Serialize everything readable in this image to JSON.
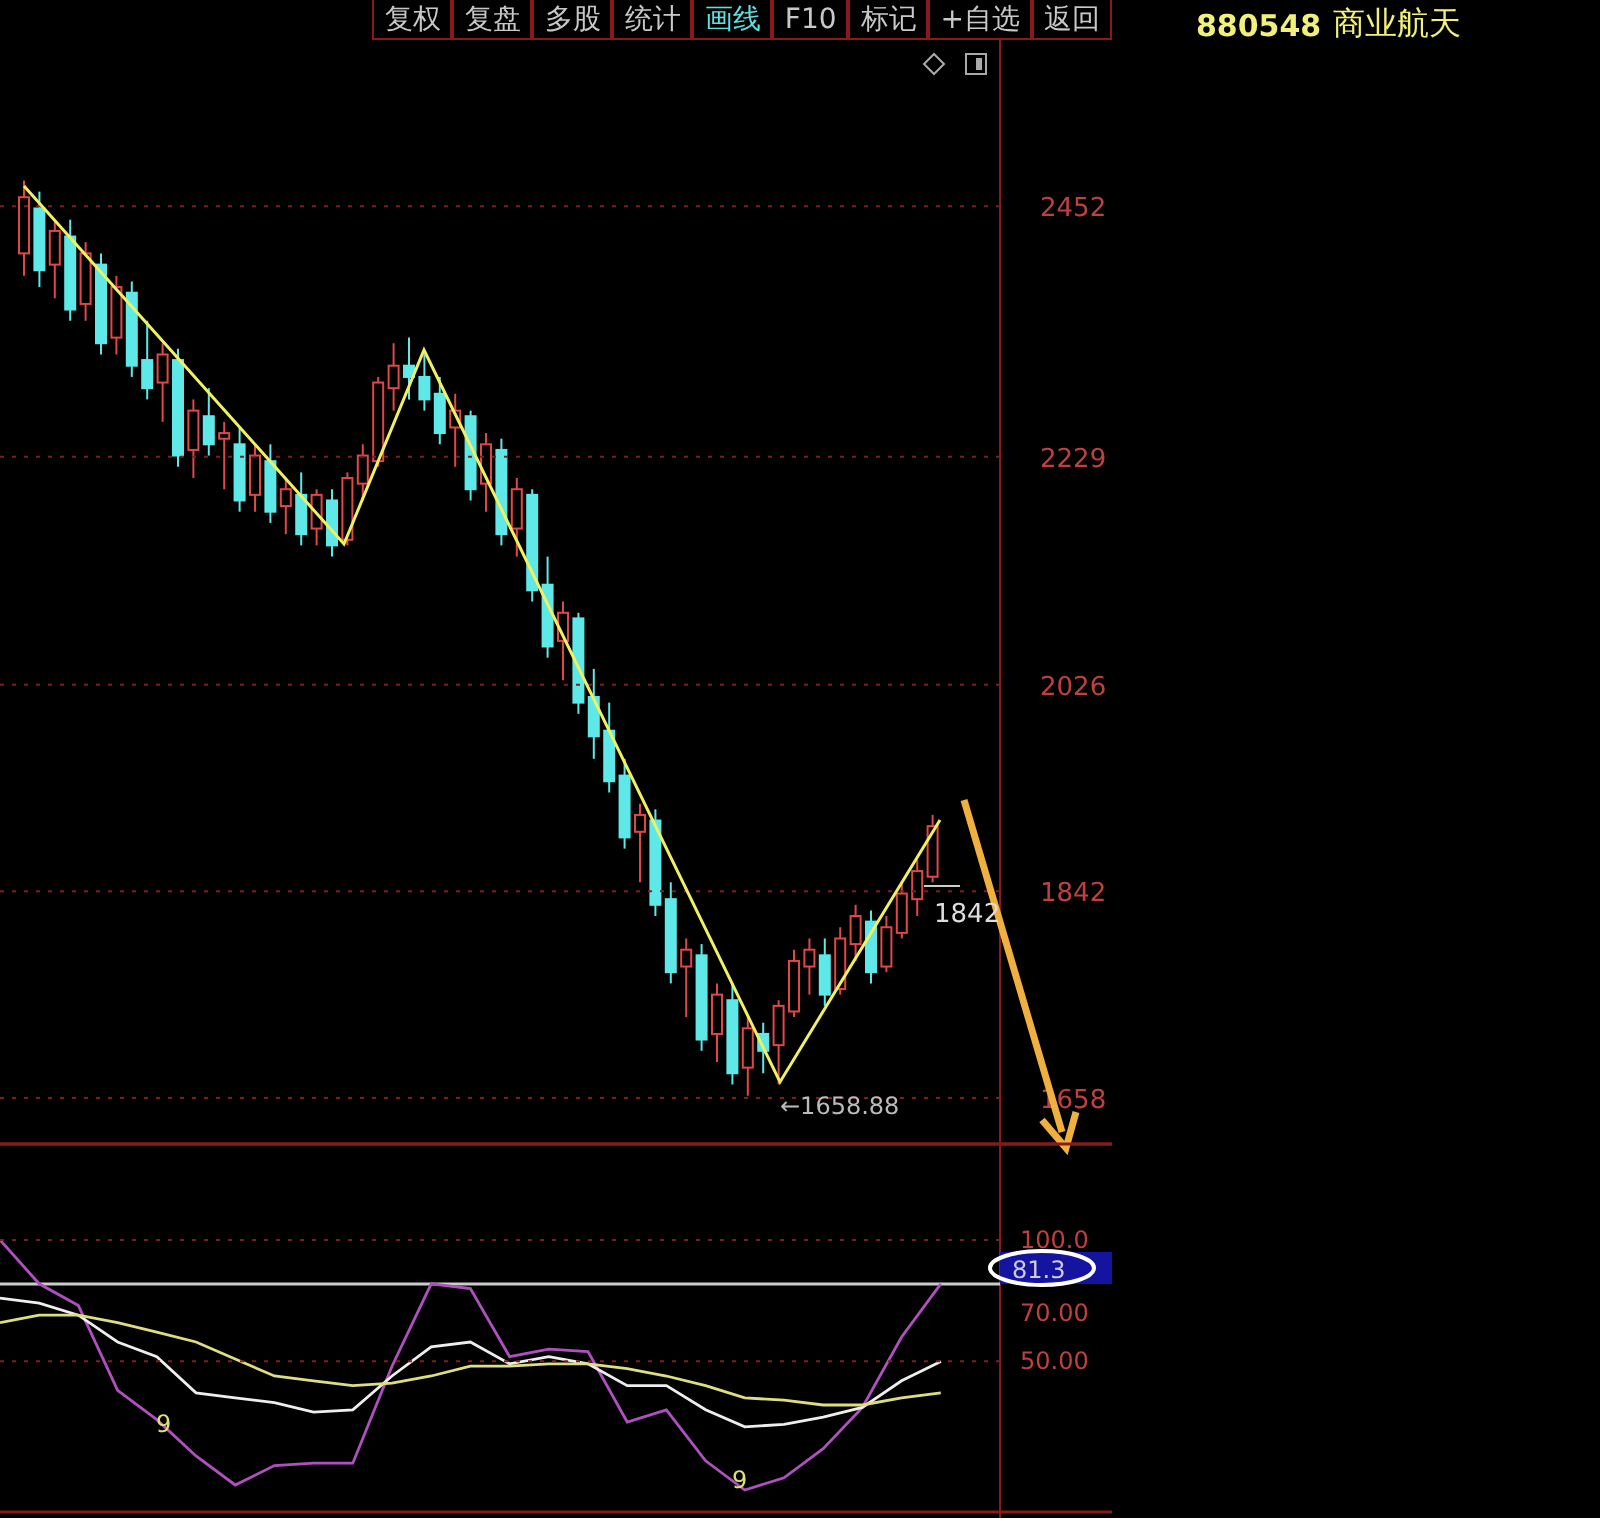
{
  "toolbar": {
    "buttons": [
      {
        "label": "复权",
        "selected": false
      },
      {
        "label": "复盘",
        "selected": false
      },
      {
        "label": "多股",
        "selected": false
      },
      {
        "label": "统计",
        "selected": false
      },
      {
        "label": "画线",
        "selected": true
      },
      {
        "label": "F10",
        "selected": false
      },
      {
        "label": "标记",
        "selected": false
      },
      {
        "label": "+自选",
        "selected": false
      },
      {
        "label": "返回",
        "selected": false
      }
    ]
  },
  "security": {
    "code": "880548",
    "name": "商业航天"
  },
  "price_chart": {
    "last_price_label": "1842",
    "low_label": "←1658.88",
    "chart_data": {
      "type": "candlestick",
      "grid": true,
      "ylim": [
        1617,
        2600
      ],
      "yticks": [
        2452,
        2229,
        2026,
        1842,
        1658
      ],
      "ohlc": [
        [
          2410,
          2475,
          2390,
          2460
        ],
        [
          2450,
          2465,
          2380,
          2395
        ],
        [
          2400,
          2440,
          2370,
          2430
        ],
        [
          2425,
          2440,
          2350,
          2360
        ],
        [
          2365,
          2420,
          2350,
          2410
        ],
        [
          2400,
          2410,
          2320,
          2330
        ],
        [
          2335,
          2390,
          2320,
          2380
        ],
        [
          2375,
          2385,
          2300,
          2310
        ],
        [
          2315,
          2350,
          2280,
          2290
        ],
        [
          2295,
          2330,
          2260,
          2320
        ],
        [
          2315,
          2325,
          2220,
          2230
        ],
        [
          2235,
          2280,
          2210,
          2270
        ],
        [
          2265,
          2290,
          2230,
          2240
        ],
        [
          2245,
          2260,
          2200,
          2250
        ],
        [
          2240,
          2255,
          2180,
          2190
        ],
        [
          2195,
          2240,
          2180,
          2230
        ],
        [
          2225,
          2240,
          2170,
          2180
        ],
        [
          2185,
          2210,
          2160,
          2200
        ],
        [
          2195,
          2215,
          2150,
          2160
        ],
        [
          2165,
          2200,
          2150,
          2195
        ],
        [
          2190,
          2200,
          2140,
          2150
        ],
        [
          2155,
          2215,
          2150,
          2210
        ],
        [
          2205,
          2240,
          2190,
          2230
        ],
        [
          2225,
          2300,
          2220,
          2295
        ],
        [
          2290,
          2330,
          2270,
          2310
        ],
        [
          2310,
          2335,
          2280,
          2300
        ],
        [
          2300,
          2320,
          2270,
          2280
        ],
        [
          2285,
          2300,
          2240,
          2250
        ],
        [
          2255,
          2285,
          2220,
          2270
        ],
        [
          2265,
          2270,
          2190,
          2200
        ],
        [
          2205,
          2250,
          2180,
          2240
        ],
        [
          2235,
          2245,
          2150,
          2160
        ],
        [
          2165,
          2210,
          2140,
          2200
        ],
        [
          2195,
          2200,
          2100,
          2110
        ],
        [
          2115,
          2140,
          2050,
          2060
        ],
        [
          2065,
          2100,
          2030,
          2090
        ],
        [
          2085,
          2090,
          2000,
          2010
        ],
        [
          2015,
          2040,
          1960,
          1980
        ],
        [
          1985,
          2010,
          1930,
          1940
        ],
        [
          1945,
          1960,
          1880,
          1890
        ],
        [
          1895,
          1920,
          1850,
          1910
        ],
        [
          1905,
          1915,
          1820,
          1830
        ],
        [
          1835,
          1850,
          1760,
          1770
        ],
        [
          1775,
          1800,
          1730,
          1790
        ],
        [
          1785,
          1795,
          1700,
          1710
        ],
        [
          1715,
          1760,
          1690,
          1750
        ],
        [
          1745,
          1760,
          1670,
          1680
        ],
        [
          1685,
          1730,
          1660,
          1720
        ],
        [
          1715,
          1725,
          1680,
          1700
        ],
        [
          1705,
          1745,
          1670,
          1740
        ],
        [
          1735,
          1790,
          1730,
          1780
        ],
        [
          1775,
          1800,
          1750,
          1790
        ],
        [
          1785,
          1800,
          1740,
          1750
        ],
        [
          1755,
          1810,
          1750,
          1800
        ],
        [
          1795,
          1830,
          1780,
          1820
        ],
        [
          1815,
          1825,
          1760,
          1770
        ],
        [
          1775,
          1820,
          1770,
          1810
        ],
        [
          1805,
          1850,
          1800,
          1840
        ],
        [
          1835,
          1870,
          1820,
          1860
        ],
        [
          1855,
          1910,
          1850,
          1900
        ]
      ]
    }
  },
  "indicator": {
    "current_value": "81.3",
    "markers": [
      "9",
      "9"
    ],
    "chart_data": {
      "type": "line",
      "grid": true,
      "ylim": [
        -12.1,
        139.6
      ],
      "yticks": [
        {
          "value": 100,
          "label": "100.0"
        },
        {
          "value": 70,
          "label": "70.00"
        },
        {
          "value": 50,
          "label": "50.00"
        }
      ],
      "series": [
        {
          "color": "#b050c0",
          "values": [
            100,
            82,
            73,
            38,
            26,
            11,
            -1,
            7,
            8,
            8,
            48,
            82,
            80,
            52,
            55,
            54,
            25,
            30,
            9,
            -3,
            2,
            14,
            31,
            60,
            82
          ]
        },
        {
          "color": "#eeeeee",
          "values": [
            76,
            74,
            69,
            58,
            52,
            37,
            35,
            33,
            29,
            30,
            44,
            56,
            58,
            49,
            52,
            49,
            40,
            40,
            30,
            23,
            24,
            27,
            31,
            42,
            50
          ]
        },
        {
          "color": "#dede80",
          "values": [
            66,
            69,
            69,
            66,
            62,
            58,
            51,
            44,
            42,
            40,
            41,
            44,
            48,
            48,
            49,
            49,
            47,
            44,
            40,
            35,
            34,
            32,
            32,
            35,
            37
          ]
        }
      ]
    }
  }
}
